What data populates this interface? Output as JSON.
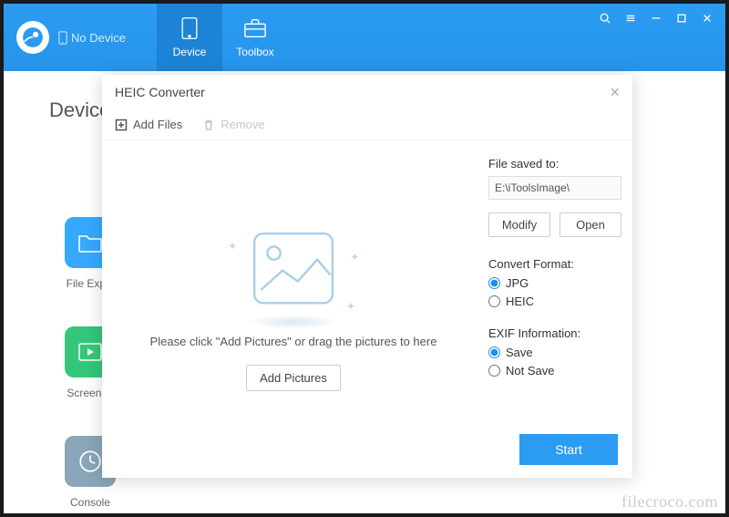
{
  "header": {
    "device_status": "No Device",
    "tabs": {
      "device": "Device",
      "toolbox": "Toolbox"
    }
  },
  "page": {
    "title": "Device",
    "watermark": "filecroco.com"
  },
  "tools": {
    "file_explorer": "File Explo",
    "screen_mirror": "Screen M",
    "console": "Console"
  },
  "dialog": {
    "title": "HEIC Converter",
    "toolbar": {
      "add": "Add Files",
      "remove": "Remove"
    },
    "drop_text": "Please click \"Add Pictures\" or drag the pictures to here",
    "add_pictures": "Add Pictures",
    "save_section": {
      "label": "File saved to:",
      "path": "E:\\iToolsImage\\",
      "modify": "Modify",
      "open": "Open"
    },
    "format": {
      "label": "Convert Format:",
      "jpg": "JPG",
      "heic": "HEIC",
      "selected": "jpg"
    },
    "exif": {
      "label": "EXIF Information:",
      "save": "Save",
      "not_save": "Not Save",
      "selected": "save"
    },
    "start": "Start"
  }
}
